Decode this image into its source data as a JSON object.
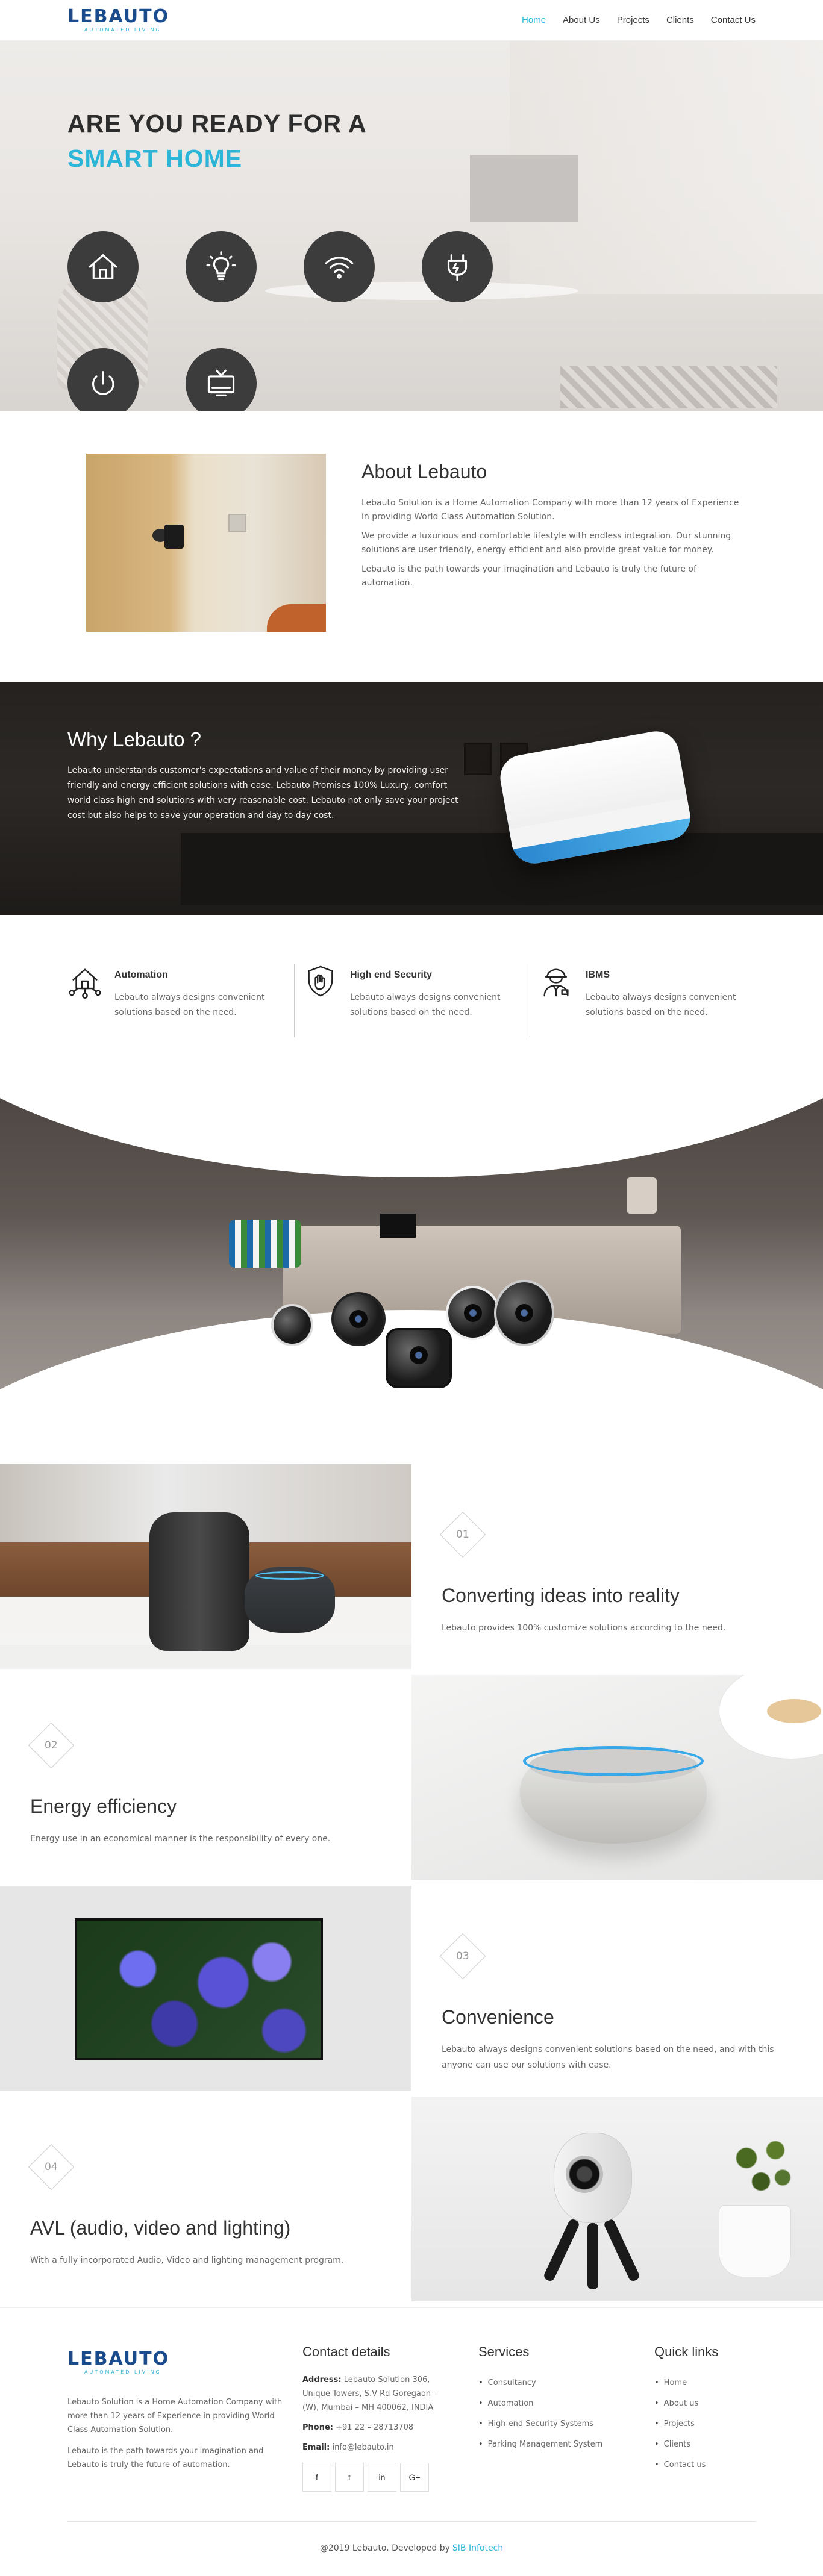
{
  "nav": {
    "logo_text": "LEBAUTO",
    "logo_tagline": "AUTOMATED LIVING",
    "items": [
      {
        "label": "Home",
        "active": true
      },
      {
        "label": "About Us"
      },
      {
        "label": "Projects"
      },
      {
        "label": "Clients"
      },
      {
        "label": "Contact Us"
      }
    ]
  },
  "hero": {
    "line1": "ARE YOU READY FOR A",
    "line2": "SMART HOME",
    "icons": [
      "home-icon",
      "bulb-icon",
      "wifi-icon",
      "plug-icon",
      "power-icon",
      "tv-icon"
    ]
  },
  "about": {
    "title": "About Lebauto",
    "paragraphs": [
      "Lebauto Solution is a Home Automation Company with more than 12 years of Experience in providing World Class Automation Solution.",
      "We provide a luxurious and comfortable lifestyle with endless integration. Our stunning solutions are user friendly, energy efficient and also provide great value for money.",
      "Lebauto is the path towards your imagination and Lebauto is truly the future of automation."
    ]
  },
  "why": {
    "title": "Why Lebauto ?",
    "text": "Lebauto understands customer's expectations and value of their money by providing user friendly and energy efficient solutions with ease. Lebauto Promises 100% Luxury, comfort world class high end solutions with very reasonable cost. Lebauto not only save your project cost but also helps to save your operation and day to day cost."
  },
  "features": [
    {
      "title": "Automation",
      "text": "Lebauto always designs convenient solutions based on the need.",
      "icon": "house-network-icon"
    },
    {
      "title": "High end Security",
      "text": "Lebauto always designs convenient solutions based on the need.",
      "icon": "shield-hand-icon"
    },
    {
      "title": "IBMS",
      "text": "Lebauto always designs convenient solutions based on the need.",
      "icon": "engineer-icon"
    }
  ],
  "blocks": [
    {
      "num": "01",
      "title": "Converting ideas into reality",
      "text": "Lebauto provides 100% customize solutions according to the need."
    },
    {
      "num": "02",
      "title": "Energy efficiency",
      "text": "Energy use in an economical manner is the responsibility of every one."
    },
    {
      "num": "03",
      "title": "Convenience",
      "text": "Lebauto always designs convenient solutions based on the need, and with this anyone can use our solutions with ease."
    },
    {
      "num": "04",
      "title": "AVL (audio, video and lighting)",
      "text": "With a fully incorporated Audio, Video and lighting management program."
    }
  ],
  "footer": {
    "about": [
      "Lebauto Solution is a Home Automation Company with more than 12 years of Experience in providing World Class Automation Solution.",
      "Lebauto is the path towards your imagination and Lebauto is truly the future of automation."
    ],
    "contact_title": "Contact details",
    "address_label": "Address:",
    "address": "Lebauto Solution 306, Unique Towers, S.V Rd Goregaon – (W), Mumbai – MH 400062, INDIA",
    "phone_label": "Phone:",
    "phone": "+91 22 – 28713708",
    "email_label": "Email:",
    "email": "info@lebauto.in",
    "social": [
      "f",
      "t",
      "in",
      "G+"
    ],
    "services_title": "Services",
    "services": [
      "Consultancy",
      "Automation",
      "High end Security Systems",
      "Parking Management System"
    ],
    "links_title": "Quick links",
    "links": [
      "Home",
      "About us",
      "Projects",
      "Clients",
      "Contact us"
    ]
  },
  "copyright": {
    "text": "@2019 Lebauto. Developed by",
    "link": "SIB Infotech"
  },
  "colors": {
    "accent": "#2bb5d8",
    "brand": "#1a4b8c"
  }
}
